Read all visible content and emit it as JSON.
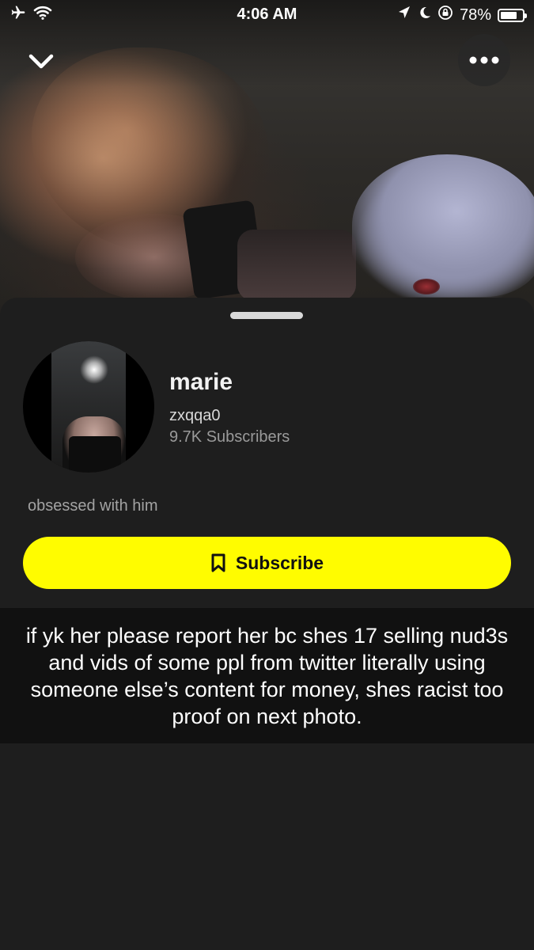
{
  "status_bar": {
    "time": "4:06 AM",
    "battery": "78%",
    "battery_level": 0.78,
    "icons": [
      "airplane-icon",
      "wifi-icon",
      "location-icon",
      "moon-icon",
      "rotation-lock-icon",
      "battery-icon"
    ]
  },
  "header": {
    "collapse_icon": "chevron-down-icon",
    "more_icon": "more-dots-icon"
  },
  "profile": {
    "display_name": "marie",
    "username": "zxqqa0",
    "subscribers": "9.7K Subscribers",
    "bio": "obsessed with him"
  },
  "subscribe_button": {
    "label": "Subscribe",
    "icon": "bookmark-icon",
    "color": "#fffc00"
  },
  "caption": {
    "text": "if yk her please report her bc shes 17 selling nud3s and vids of some ppl from twitter literally using someone else’s content for money, shes racist too proof on next photo."
  }
}
